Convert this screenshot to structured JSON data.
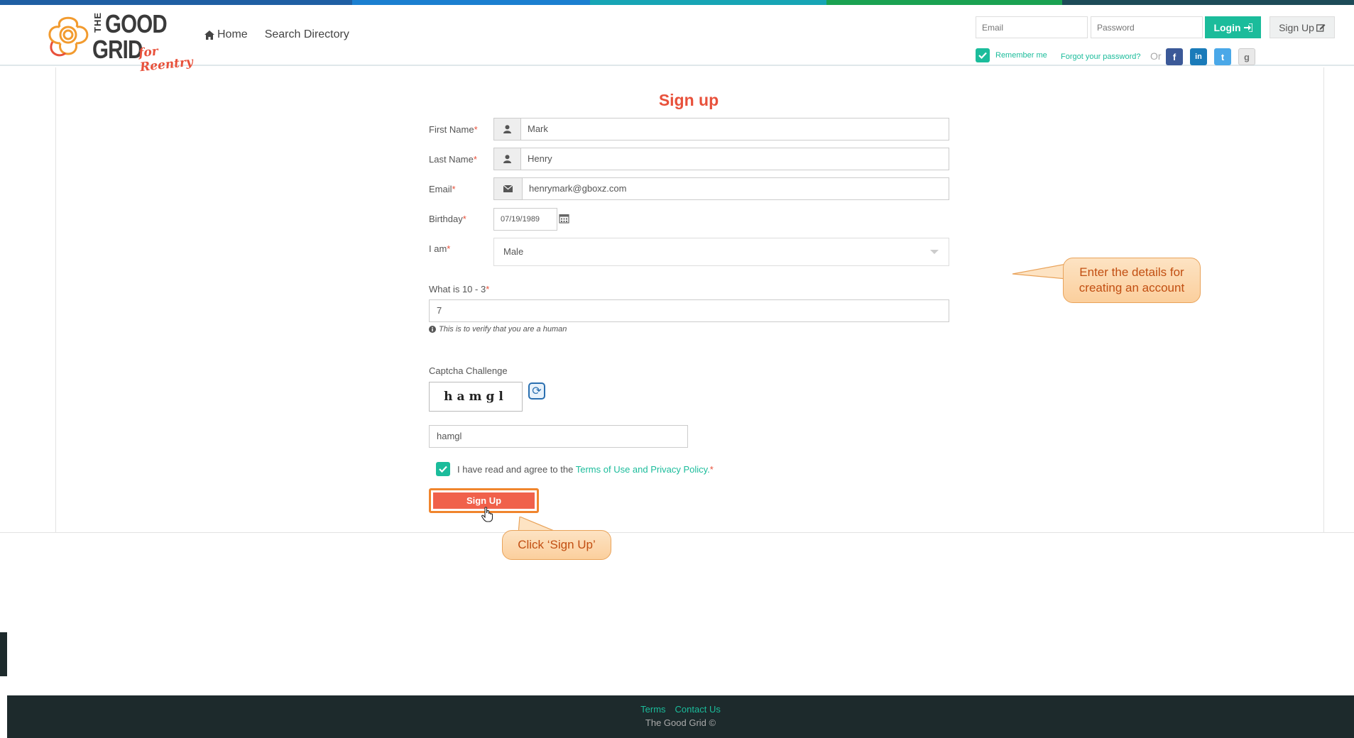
{
  "colors": {
    "accent": "#1bbc9b",
    "brand_red": "#e8513b",
    "signup_button": "#f0614b",
    "footer_bg": "#1d2a2c"
  },
  "logo": {
    "line1": "THE",
    "line2": "GOOD",
    "line3": "GRID",
    "tagline": "for Reentry"
  },
  "nav": {
    "home": "Home",
    "search_directory": "Search Directory"
  },
  "login": {
    "email_placeholder": "Email",
    "password_placeholder": "Password",
    "login_button": "Login",
    "signup_button": "Sign Up",
    "remember_me": "Remember me",
    "forgot_password": "Forgot your password?",
    "or": "Or",
    "social": [
      "facebook-icon",
      "linkedin-icon",
      "twitter-icon",
      "google-icon"
    ]
  },
  "form": {
    "title": "Sign up",
    "first_name_label": "First Name",
    "first_name_value": "Mark",
    "last_name_label": "Last Name",
    "last_name_value": "Henry",
    "email_label": "Email",
    "email_value": "henrymark@gboxz.com",
    "birthday_label": "Birthday",
    "birthday_value": "07/19/1989",
    "gender_label": "I am",
    "gender_value": "Male",
    "math_label": "What is 10 - 3",
    "math_value": "7",
    "math_hint": "This is to verify that you are a human",
    "captcha_label": "Captcha Challenge",
    "captcha_text": "hamgl",
    "captcha_value": "hamgl",
    "terms_prefix": "I have read and agree to the",
    "terms_link": "Terms of Use and Privacy Policy.",
    "terms_checked": true,
    "submit_label": "Sign Up",
    "required_mark": "*"
  },
  "callouts": {
    "details": "Enter the details for creating an account",
    "click": "Click ‘Sign Up’"
  },
  "footer": {
    "terms": "Terms",
    "contact": "Contact Us",
    "copyright": "The Good Grid ©"
  }
}
